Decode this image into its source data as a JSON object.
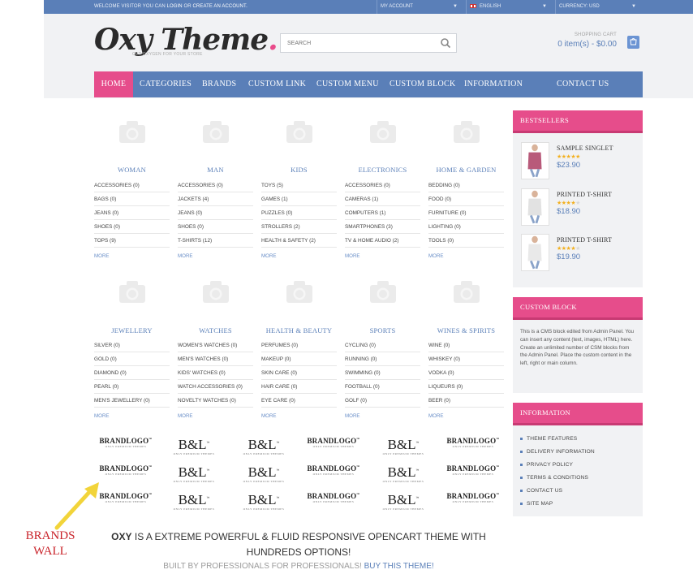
{
  "topbar": {
    "welcome_prefix": "WELCOME VISITOR YOU CAN",
    "login": "LOGIN",
    "or": "OR",
    "create_account": "CREATE AN ACCOUNT.",
    "my_account": "MY ACCOUNT",
    "language": "ENGLISH",
    "currency": "CURRENCY: USD"
  },
  "header": {
    "logo": "Oxy Theme",
    "logo_dot": ".",
    "tagline": "GET OXYGEN FOR YOUR STORE",
    "search_placeholder": "SEARCH",
    "cart_label": "SHOPPING CART",
    "cart_items": "0 item(s) - $0.00"
  },
  "nav": {
    "items": [
      "HOME",
      "CATEGORIES",
      "BRANDS",
      "CUSTOM LINK",
      "CUSTOM MENU",
      "CUSTOM BLOCK",
      "INFORMATION",
      "CONTACT US"
    ]
  },
  "categories": [
    {
      "title": "WOMAN",
      "items": [
        "ACCESSORIES (0)",
        "BAGS (0)",
        "JEANS (0)",
        "SHOES (0)",
        "TOPS (9)"
      ],
      "more": "MORE"
    },
    {
      "title": "MAN",
      "items": [
        "ACCESSORIES (0)",
        "JACKETS (4)",
        "JEANS (0)",
        "SHOES (0)",
        "T-SHIRTS (12)"
      ],
      "more": "MORE"
    },
    {
      "title": "KIDS",
      "items": [
        "TOYS (5)",
        "GAMES (1)",
        "PUZZLES (0)",
        "STROLLERS (2)",
        "HEALTH & SAFETY (2)"
      ],
      "more": "MORE"
    },
    {
      "title": "ELECTRONICS",
      "items": [
        "ACCESSORIES (0)",
        "CAMERAS (1)",
        "COMPUTERS (1)",
        "SMARTPHONES (3)",
        "TV & HOME AUDIO (2)"
      ],
      "more": "MORE"
    },
    {
      "title": "HOME & GARDEN",
      "items": [
        "BEDDING (0)",
        "FOOD (0)",
        "FURNITURE (0)",
        "LIGHTING (0)",
        "TOOLS (0)"
      ],
      "more": "MORE"
    },
    {
      "title": "JEWELLERY",
      "items": [
        "SILVER (0)",
        "GOLD (0)",
        "DIAMOND (0)",
        "PEARL (0)",
        "MEN'S JEWELLERY (0)"
      ],
      "more": "MORE"
    },
    {
      "title": "WATCHES",
      "items": [
        "WOMEN'S WATCHES (0)",
        "MEN'S WATCHES (0)",
        "KIDS' WATCHES (0)",
        "WATCH ACCESSORIES (0)",
        "NOVELTY WATCHES (0)"
      ],
      "more": "MORE"
    },
    {
      "title": "HEALTH & BEAUTY",
      "items": [
        "PERFUMES (0)",
        "MAKEUP (0)",
        "SKIN CARE (0)",
        "HAIR CARE (0)",
        "EYE CARE (0)"
      ],
      "more": "MORE"
    },
    {
      "title": "SPORTS",
      "items": [
        "CYCLING (0)",
        "RUNNING (0)",
        "SWIMMING (0)",
        "FOOTBALL (0)",
        "GOLF (0)"
      ],
      "more": "MORE"
    },
    {
      "title": "WINES & SPIRITS",
      "items": [
        "WINE (0)",
        "WHISKEY (0)",
        "VODKA (0)",
        "LIQUEURS (0)",
        "BEER (0)"
      ],
      "more": "MORE"
    }
  ],
  "brands": {
    "rows": [
      [
        "brandlogo",
        "bnl",
        "bnl",
        "brandlogo",
        "bnl",
        "brandlogo"
      ],
      [
        "brandlogo",
        "bnl",
        "bnl",
        "brandlogo",
        "bnl",
        "brandlogo"
      ],
      [
        "brandlogo",
        "bnl",
        "bnl",
        "brandlogo",
        "bnl",
        "brandlogo"
      ]
    ],
    "brandlogo_text": "BRANDLOGO",
    "brandlogo_tm": "™",
    "brandlogo_sub": "ONLY PREMIUM THEMES",
    "bnl_text": "B&L",
    "bnl_tm": "™",
    "bnl_sub": "ONLY PREMIUM THEMES"
  },
  "annotation": {
    "brands_wall_line1": "BRANDS",
    "brands_wall_line2": "WALL"
  },
  "footer_promo": {
    "oxy": "OXY",
    "text": "IS A EXTREME POWERFUL & FLUID RESPONSIVE OPENCART THEME WITH HUNDREDS OPTIONS!",
    "built": "BUILT BY PROFESSIONALS FOR PROFESSIONALS!",
    "buy": "BUY THIS THEME!"
  },
  "sidebar": {
    "bestsellers_title": "BESTSELLERS",
    "bestsellers": [
      {
        "name": "SAMPLE SINGLET",
        "price": "$23.90",
        "rating": 5
      },
      {
        "name": "PRINTED T-SHIRT",
        "price": "$18.90",
        "rating": 4
      },
      {
        "name": "PRINTED T-SHIRT",
        "price": "$19.90",
        "rating": 4
      }
    ],
    "custom_block_title": "CUSTOM BLOCK",
    "custom_block_text": "This is a CMS block edited from Admin Panel. You can insert any content (text, images, HTML) here. Create an unlimited number of CSM blocks from the Admin Panel. Place the custom content in the left, right or main column.",
    "information_title": "INFORMATION",
    "information_links": [
      "THEME FEATURES",
      "DELIVERY INFORMATION",
      "PRIVACY POLICY",
      "TERMS & CONDITIONS",
      "CONTACT US",
      "SITE MAP"
    ]
  },
  "colors": {
    "accent_blue": "#5a7fb8",
    "accent_pink": "#e64d8b",
    "annotation_red": "#c9232a",
    "arrow_yellow": "#f2d43a"
  }
}
